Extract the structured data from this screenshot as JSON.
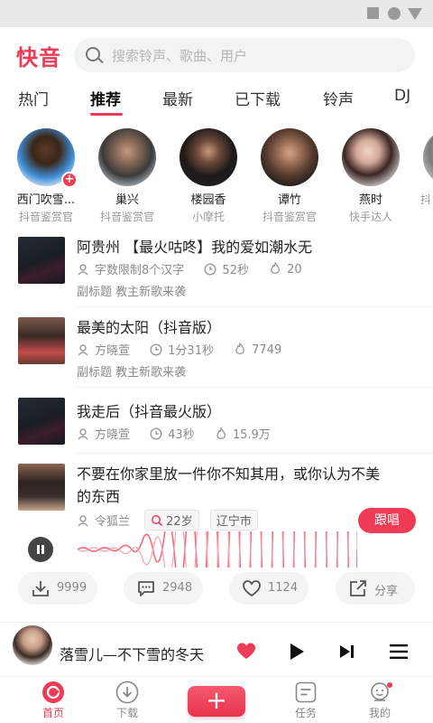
{
  "app": {
    "logo": "快音",
    "accent": "#ee3b56"
  },
  "search": {
    "placeholder": "搜索铃声、歌曲、用户"
  },
  "tabs": [
    {
      "label": "热门"
    },
    {
      "label": "推荐",
      "active": true
    },
    {
      "label": "最新"
    },
    {
      "label": "已下载"
    },
    {
      "label": "铃声"
    },
    {
      "label": "DJ"
    }
  ],
  "avatars": [
    {
      "name": "西门吹雪...",
      "sub": "抖音鉴赏官"
    },
    {
      "name": "巢兴",
      "sub": "抖音鉴赏官"
    },
    {
      "name": "楼园香",
      "sub": "小摩托"
    },
    {
      "name": "谭竹",
      "sub": "抖音鉴赏官"
    },
    {
      "name": "燕时",
      "sub": "快手达人"
    },
    {
      "name": "",
      "sub": "抖"
    }
  ],
  "songs": [
    {
      "title": "阿贵州 【最火咕咚】我的爱如潮水无",
      "author": "字数限制8个汉字",
      "duration": "52秒",
      "heat": "20",
      "subtitle": "副标题 教主新歌来袭"
    },
    {
      "title": "最美的太阳（抖音版）",
      "author": "方晓萱",
      "duration": "1分31秒",
      "heat": "7749",
      "subtitle": "副标题 教主新歌来袭"
    },
    {
      "title": "我走后（抖音最火版）",
      "author": "方晓萱",
      "duration": "43秒",
      "heat": "15.9万"
    },
    {
      "title_line1": "不要在你家里放一件你不知其用，或你认为不美",
      "title_line2": "的东西",
      "author": "令狐兰",
      "age_tag": "22岁",
      "city_tag": "辽宁市",
      "follow_label": "跟唱"
    }
  ],
  "actions": {
    "download": "9999",
    "comment": "2948",
    "like": "1124",
    "share": "分享"
  },
  "player": {
    "title": "落雪儿—不下雪的冬天",
    "liked": true
  },
  "tabbar": [
    {
      "label": "首页",
      "active": true
    },
    {
      "label": "下载"
    },
    {
      "label": "+"
    },
    {
      "label": "任务"
    },
    {
      "label": "我的"
    }
  ]
}
